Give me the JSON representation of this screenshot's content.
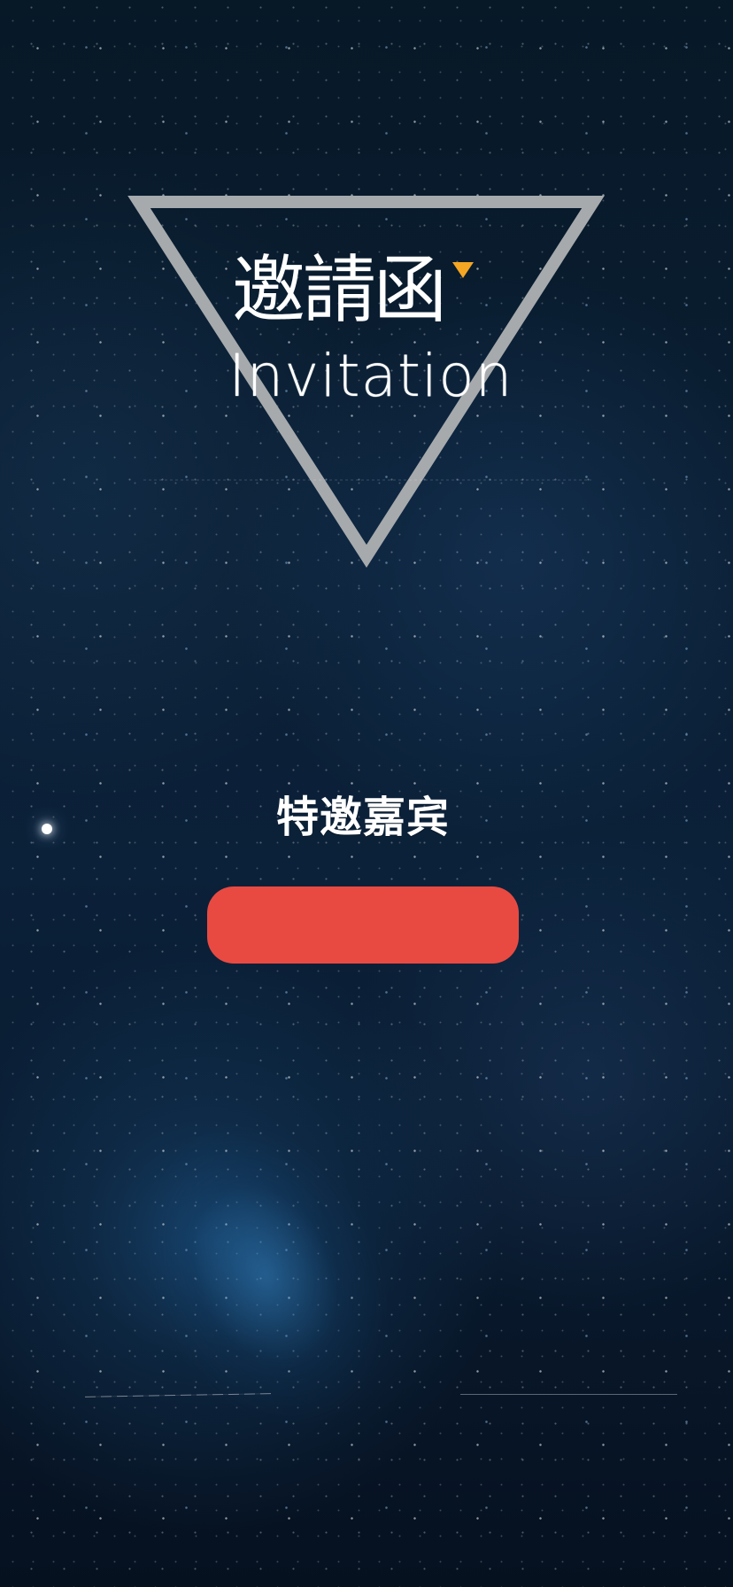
{
  "invitation": {
    "logo": {
      "chinese_title": "邀請函",
      "english_title": "Invitation"
    },
    "special_guest_label": "特邀嘉宾",
    "guest_button_label": ""
  },
  "colors": {
    "button": "#e84a42",
    "triangle": "#a6aaad",
    "accent": "#f5a623"
  }
}
